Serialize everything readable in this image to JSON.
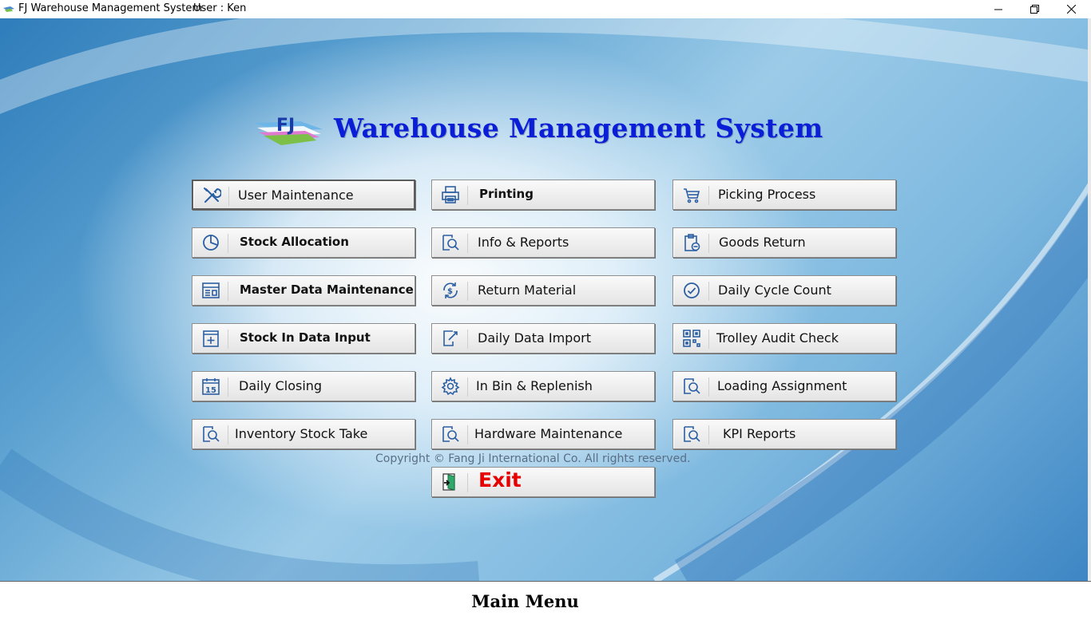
{
  "window": {
    "title": "FJ Warehouse Management System",
    "user_label": "User : Ken",
    "controls": [
      "minimize",
      "restore",
      "close"
    ]
  },
  "header": {
    "logo_text": "FJ",
    "title": "Warehouse Management System"
  },
  "buttons": {
    "user_maintenance": {
      "label": "User Maintenance",
      "icon": "tools-icon"
    },
    "printing": {
      "label": "Printing",
      "icon": "printer-icon"
    },
    "picking_process": {
      "label": "Picking Process",
      "icon": "cart-icon"
    },
    "stock_allocation": {
      "label": "Stock Allocation",
      "icon": "pie-chart-icon"
    },
    "info_reports": {
      "label": "Info & Reports",
      "icon": "report-search-icon"
    },
    "goods_return": {
      "label": "Goods Return",
      "icon": "clipboard-return-icon"
    },
    "master_data_maintenance": {
      "label": "Master Data Maintenance",
      "icon": "data-window-icon"
    },
    "return_material": {
      "label": "Return Material",
      "icon": "money-cycle-icon"
    },
    "daily_cycle_count": {
      "label": "Daily Cycle Count",
      "icon": "check-circle-icon"
    },
    "stock_in_data_input": {
      "label": "Stock In Data Input",
      "icon": "add-calendar-icon"
    },
    "daily_data_import": {
      "label": "Daily Data Import",
      "icon": "import-doc-icon"
    },
    "trolley_audit_check": {
      "label": "Trolley Audit Check",
      "icon": "qr-code-icon"
    },
    "daily_closing": {
      "label": "Daily Closing",
      "icon": "calendar-15-icon"
    },
    "in_bin_replenish": {
      "label": "In Bin & Replenish",
      "icon": "gear-icon"
    },
    "loading_assignment": {
      "label": "Loading Assignment",
      "icon": "report-search-icon"
    },
    "inventory_stock_take": {
      "label": "Inventory Stock Take",
      "icon": "report-search-icon"
    },
    "hardware_maintenance": {
      "label": "Hardware Maintenance",
      "icon": "report-search-icon"
    },
    "kpi_reports": {
      "label": "KPI Reports",
      "icon": "report-search-icon"
    },
    "exit": {
      "label": "Exit",
      "icon": "exit-door-icon"
    }
  },
  "copyright": "Copyright © Fang Ji International Co. All rights reserved.",
  "footer": {
    "title": "Main Menu"
  },
  "colors": {
    "heading": "#0a1ed8",
    "icon": "#2b5fa3",
    "exit_label": "#e60000",
    "copyright": "#5a6f86"
  }
}
